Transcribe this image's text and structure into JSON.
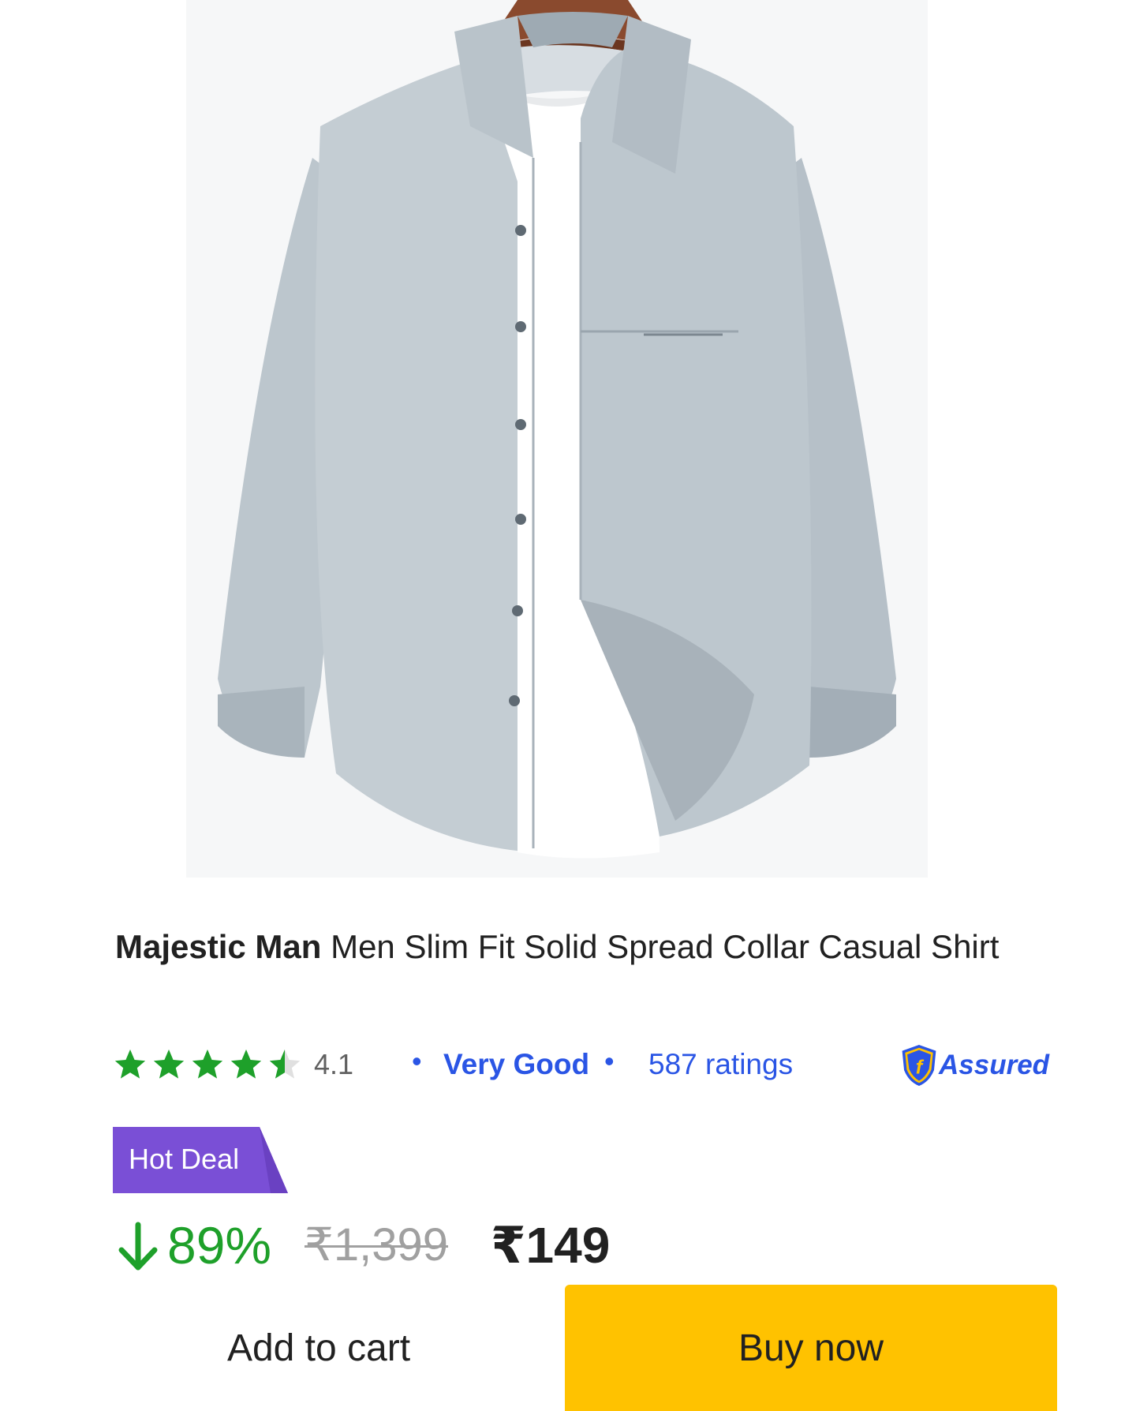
{
  "product": {
    "brand": "Majestic Man",
    "title_rest": " Men Slim Fit Solid Spread Collar Casual Shirt"
  },
  "rating": {
    "value": "4.1",
    "stars_filled": 4.1,
    "label": "Very Good",
    "count": "587 ratings",
    "assured_label": "Assured"
  },
  "deal": {
    "badge_label": "Hot Deal"
  },
  "pricing": {
    "discount": "89%",
    "mrp": "₹1,399",
    "price": "₹149"
  },
  "actions": {
    "add_to_cart_label": "Add to cart",
    "buy_now_label": "Buy now"
  },
  "colors": {
    "star_green": "#1ea02a",
    "link_blue": "#2a55e5",
    "badge_purple": "#7a4fd6",
    "buy_yellow": "#ffc200",
    "discount_green": "#1ea02a"
  },
  "icons": {
    "rating": "star-icon",
    "assured": "shield-f-icon",
    "discount": "arrow-down-icon"
  }
}
